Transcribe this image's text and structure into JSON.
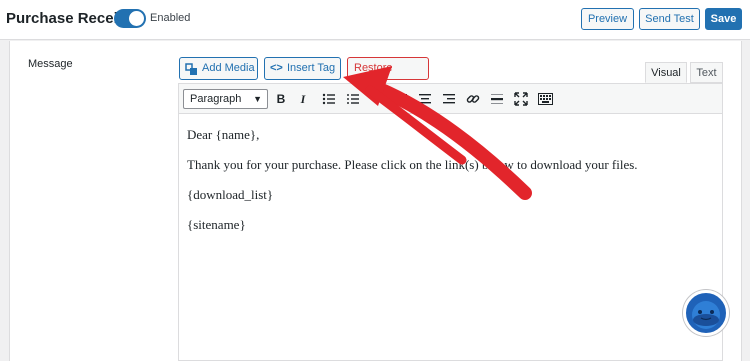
{
  "header": {
    "title": "Purchase Receipt",
    "toggle_label": "Enabled",
    "preview_label": "Preview",
    "send_test_label": "Send Test",
    "save_label": "Save"
  },
  "form": {
    "message_label": "Message"
  },
  "media_buttons": {
    "add_media": "Add Media",
    "insert_tag": "Insert Tag",
    "restore_default": "Restore Default"
  },
  "editor_tabs": {
    "visual": "Visual",
    "text": "Text"
  },
  "toolbar": {
    "format_select": "Paragraph",
    "buttons": [
      "bold-icon",
      "italic-icon",
      "bulleted-list-icon",
      "numbered-list-icon",
      "align-left-icon",
      "align-center-icon",
      "align-right-icon",
      "link-icon",
      "horizontal-line-icon",
      "fullscreen-icon",
      "toolbar-toggle-icon"
    ]
  },
  "editor": {
    "lines": [
      "Dear {name},",
      "Thank you for your purchase. Please click on the link(s) below to download your files.",
      "{download_list}",
      "{sitename}"
    ]
  },
  "colors": {
    "accent": "#2271b1",
    "danger": "#d63638",
    "arrow": "#e2252b"
  }
}
